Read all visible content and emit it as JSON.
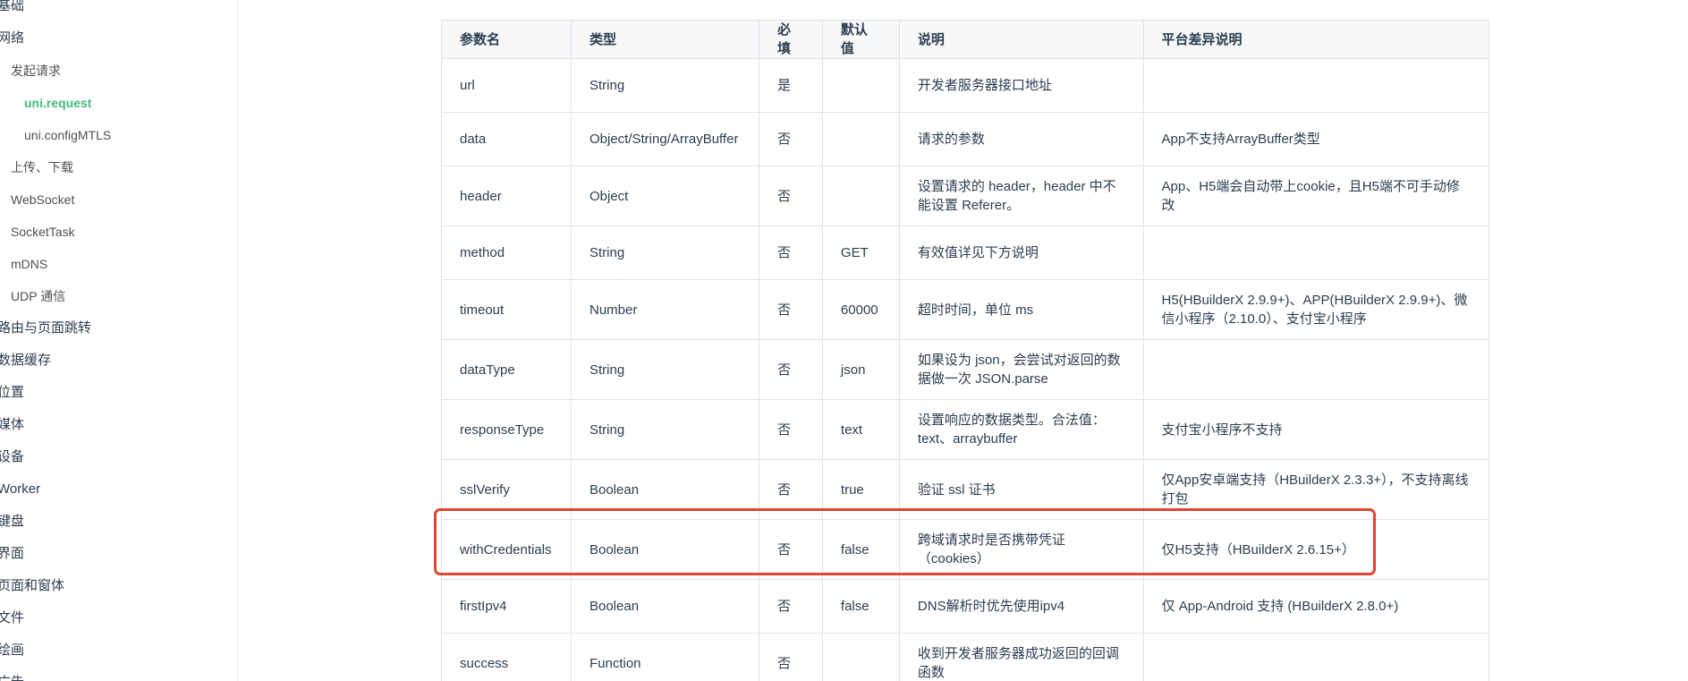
{
  "sidebar": {
    "items": [
      {
        "label": "基础",
        "level": 1
      },
      {
        "label": "网络",
        "level": 1
      },
      {
        "label": "发起请求",
        "level": 2
      },
      {
        "label": "uni.request",
        "level": 3,
        "active": true
      },
      {
        "label": "uni.configMTLS",
        "level": 3
      },
      {
        "label": "上传、下载",
        "level": 2
      },
      {
        "label": "WebSocket",
        "level": 2
      },
      {
        "label": "SocketTask",
        "level": 2
      },
      {
        "label": "mDNS",
        "level": 2
      },
      {
        "label": "UDP 通信",
        "level": 2
      },
      {
        "label": "路由与页面跳转",
        "level": 1
      },
      {
        "label": "数据缓存",
        "level": 1
      },
      {
        "label": "位置",
        "level": 1
      },
      {
        "label": "媒体",
        "level": 1
      },
      {
        "label": "设备",
        "level": 1
      },
      {
        "label": "Worker",
        "level": 1
      },
      {
        "label": "键盘",
        "level": 1
      },
      {
        "label": "界面",
        "level": 1
      },
      {
        "label": "页面和窗体",
        "level": 1
      },
      {
        "label": "文件",
        "level": 1
      },
      {
        "label": "绘画",
        "level": 1
      },
      {
        "label": "广告",
        "level": 1
      }
    ]
  },
  "table": {
    "headers": [
      "参数名",
      "类型",
      "必填",
      "默认值",
      "说明",
      "平台差异说明"
    ],
    "rows": [
      [
        "url",
        "String",
        "是",
        "",
        "开发者服务器接口地址",
        ""
      ],
      [
        "data",
        "Object/String/ArrayBuffer",
        "否",
        "",
        "请求的参数",
        "App不支持ArrayBuffer类型"
      ],
      [
        "header",
        "Object",
        "否",
        "",
        "设置请求的 header，header 中不能设置 Referer。",
        "App、H5端会自动带上cookie，且H5端不可手动修改"
      ],
      [
        "method",
        "String",
        "否",
        "GET",
        "有效值详见下方说明",
        ""
      ],
      [
        "timeout",
        "Number",
        "否",
        "60000",
        "超时时间，单位 ms",
        "H5(HBuilderX 2.9.9+)、APP(HBuilderX 2.9.9+)、微信小程序（2.10.0）、支付宝小程序"
      ],
      [
        "dataType",
        "String",
        "否",
        "json",
        "如果设为 json，会尝试对返回的数据做一次 JSON.parse",
        ""
      ],
      [
        "responseType",
        "String",
        "否",
        "text",
        "设置响应的数据类型。合法值：text、arraybuffer",
        "支付宝小程序不支持"
      ],
      [
        "sslVerify",
        "Boolean",
        "否",
        "true",
        "验证 ssl 证书",
        "仅App安卓端支持（HBuilderX 2.3.3+），不支持离线打包"
      ],
      [
        "withCredentials",
        "Boolean",
        "否",
        "false",
        "跨域请求时是否携带凭证（cookies）",
        "仅H5支持（HBuilderX 2.6.15+）"
      ],
      [
        "firstIpv4",
        "Boolean",
        "否",
        "false",
        "DNS解析时优先使用ipv4",
        "仅 App-Android 支持 (HBuilderX 2.8.0+)"
      ],
      [
        "success",
        "Function",
        "否",
        "",
        "收到开发者服务器成功返回的回调函数",
        ""
      ]
    ]
  },
  "highlight": {
    "row": "withCredentials",
    "color": "#e0452f"
  }
}
